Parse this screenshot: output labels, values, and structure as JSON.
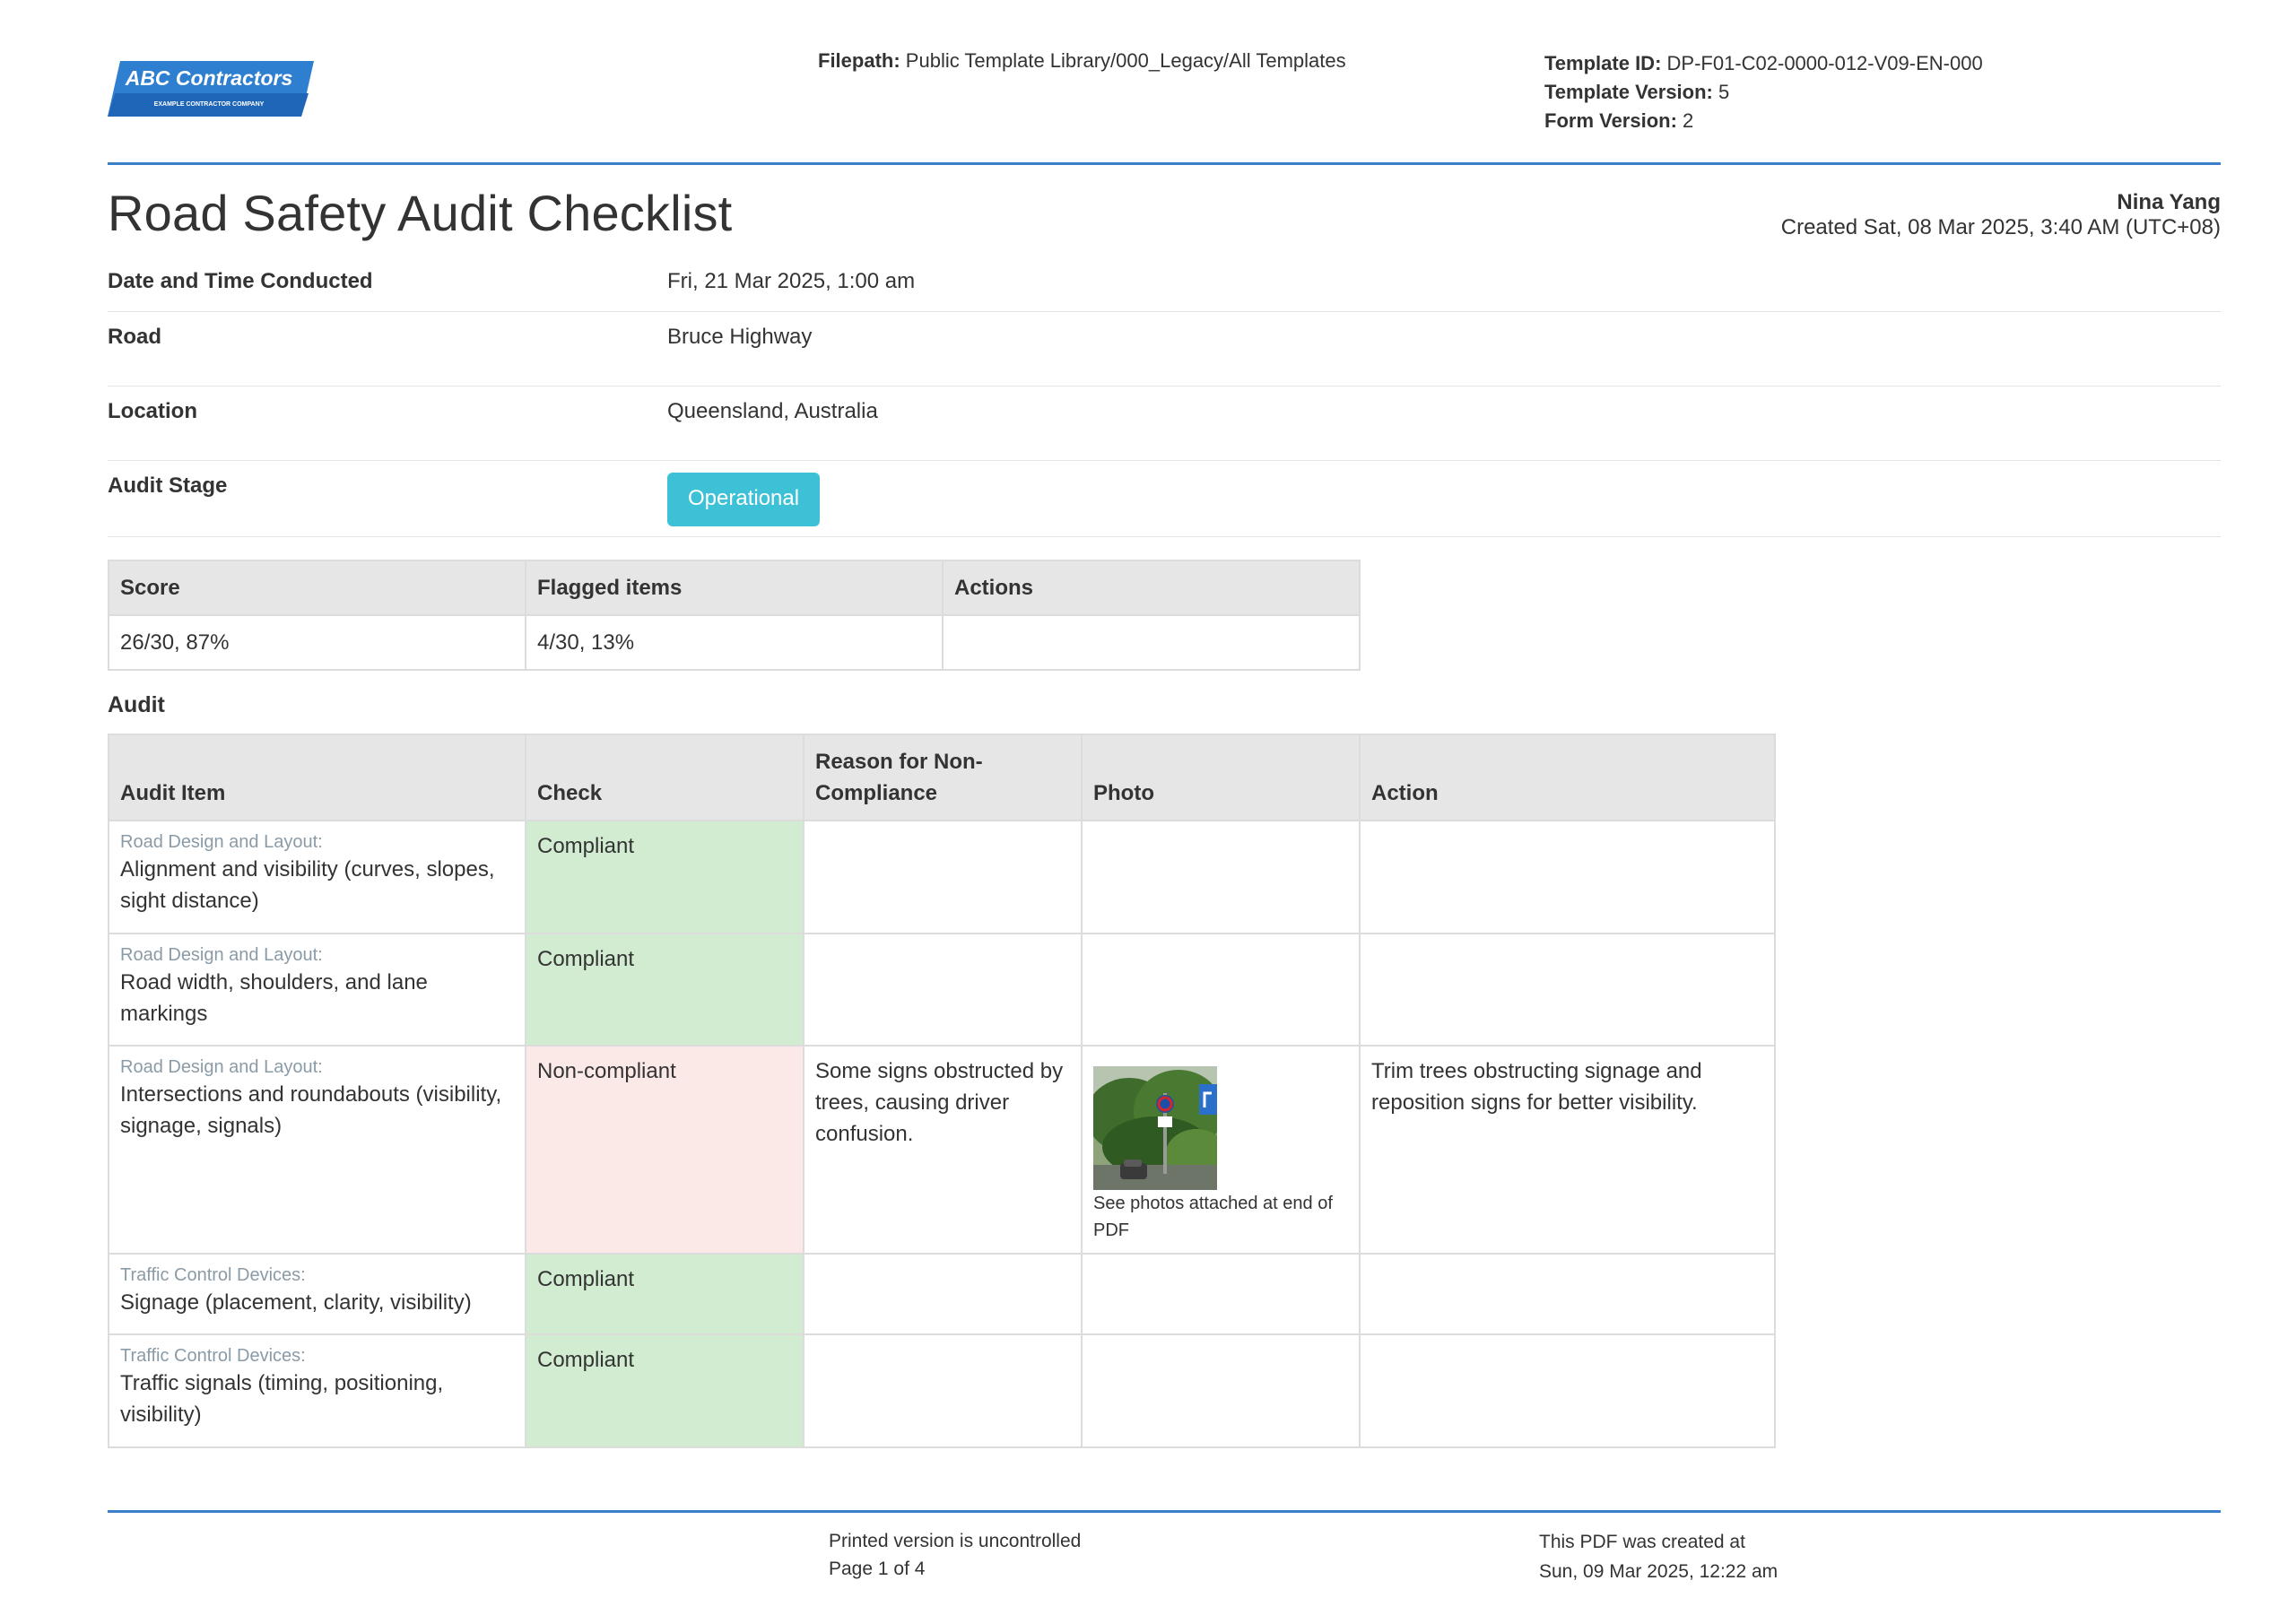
{
  "header": {
    "logo_text": "ABC Contractors",
    "logo_subtext": "EXAMPLE CONTRACTOR COMPANY",
    "filepath_label": "Filepath:",
    "filepath_value": "Public Template Library/000_Legacy/All Templates",
    "template_id_label": "Template ID:",
    "template_id_value": "DP-F01-C02-0000-012-V09-EN-000",
    "template_version_label": "Template Version:",
    "template_version_value": "5",
    "form_version_label": "Form Version:",
    "form_version_value": "2",
    "brand_color": "#2f7fd1",
    "rule_color": "#3a7fc9"
  },
  "title": "Road Safety Audit Checklist",
  "author": {
    "name": "Nina Yang",
    "created": "Created Sat, 08 Mar 2025, 3:40 AM (UTC+08)"
  },
  "fields": [
    {
      "label": "Date and Time Conducted",
      "value": "Fri, 21 Mar 2025, 1:00 am"
    },
    {
      "label": "Road",
      "value": "Bruce Highway"
    },
    {
      "label": "Location",
      "value": "Queensland, Australia"
    },
    {
      "label": "Audit Stage",
      "value": "Operational",
      "badge_color": "#3dc1d6"
    }
  ],
  "score_table": {
    "headers": [
      "Score",
      "Flagged items",
      "Actions"
    ],
    "values": [
      "26/30, 87%",
      "4/30, 13%",
      ""
    ]
  },
  "section_title": "Audit",
  "audit_table": {
    "headers": [
      "Audit Item",
      "Check",
      "Reason for Non-Compliance",
      "Photo",
      "Action"
    ],
    "rows": [
      {
        "category": "Road Design and Layout:",
        "item": "Alignment and visibility (curves, slopes, sight distance)",
        "check": "Compliant",
        "status": "ok",
        "reason": "",
        "photo_caption": "",
        "action": ""
      },
      {
        "category": "Road Design and Layout:",
        "item": "Road width, shoulders, and lane markings",
        "check": "Compliant",
        "status": "ok",
        "reason": "",
        "photo_caption": "",
        "action": ""
      },
      {
        "category": "Road Design and Layout:",
        "item": "Intersections and roundabouts (visibility, signage, signals)",
        "check": "Non-compliant",
        "status": "bad",
        "reason": "Some signs obstructed by trees, causing driver confusion.",
        "photo_caption": "See photos attached at end of PDF",
        "action": "Trim trees obstructing signage and reposition signs for better visibility."
      },
      {
        "category": "Traffic Control Devices:",
        "item": "Signage (placement, clarity, visibility)",
        "check": "Compliant",
        "status": "ok",
        "reason": "",
        "photo_caption": "",
        "action": ""
      },
      {
        "category": "Traffic Control Devices:",
        "item": "Traffic signals (timing, positioning, visibility)",
        "check": "Compliant",
        "status": "ok",
        "reason": "",
        "photo_caption": "",
        "action": ""
      }
    ],
    "compliant_color": "#d1ecd1",
    "noncompliant_color": "#fbe9e8"
  },
  "footer": {
    "uncontrolled": "Printed version is uncontrolled",
    "page": "Page 1 of 4",
    "created_label": "This PDF was created at",
    "created_value": "Sun, 09 Mar 2025, 12:22 am"
  }
}
